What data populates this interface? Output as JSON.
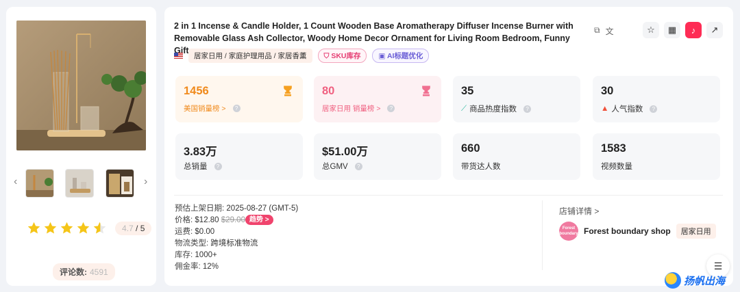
{
  "product": {
    "title": "2 in 1 Incense & Candle Holder, 1 Count Wooden Base Aromatherapy Diffuser Incense Burner with Removable Glass Ash Collector, Woody Home Decor Ornament for Living Room Bedroom, Funny Gift,...",
    "copy_icon_label": "copy-icon",
    "translate_icon_label": "文",
    "category_path": "居家日用 / 家庭护理用品 / 家居香薰",
    "sku_pill": "SKU库存",
    "ai_pill": "AI标题优化",
    "rating_value": "4.7",
    "rating_total": "/ 5",
    "rating_fraction": 0.94,
    "review_label": "评论数:",
    "review_count": "4591"
  },
  "stats": [
    {
      "value": "1456",
      "label": "美国销量榜 >"
    },
    {
      "value": "80",
      "label": "居家日用 销量榜 >"
    },
    {
      "value": "35",
      "label": "商品热度指数"
    },
    {
      "value": "30",
      "label": "人气指数"
    },
    {
      "value": "3.83万",
      "label": "总销量"
    },
    {
      "value": "$51.00万",
      "label": "总GMV"
    },
    {
      "value": "660",
      "label": "带货达人数"
    },
    {
      "value": "1583",
      "label": "视频数量"
    }
  ],
  "details": {
    "launch_label": "预估上架日期:",
    "launch_value": "2025-08-27 (GMT-5)",
    "price_label": "价格:",
    "price_value": "$12.80",
    "price_original": "$29.00",
    "trend_label": "趋势 >",
    "shipping_label": "运费:",
    "shipping_value": "$0.00",
    "logistics_label": "物流类型:",
    "logistics_value": "跨境标准物流",
    "stock_label": "库存:",
    "stock_value": "1000+",
    "commission_label": "佣金率:",
    "commission_value": "12%"
  },
  "shop": {
    "link_label": "店铺详情 >",
    "avatar_text": "Forest boundary",
    "name": "Forest boundary shop",
    "category": "居家日用"
  },
  "watermark": "扬帆出海",
  "colors": {
    "orange": "#f08a1c",
    "pink": "#f06080",
    "tiktok": "#fe2c55"
  }
}
